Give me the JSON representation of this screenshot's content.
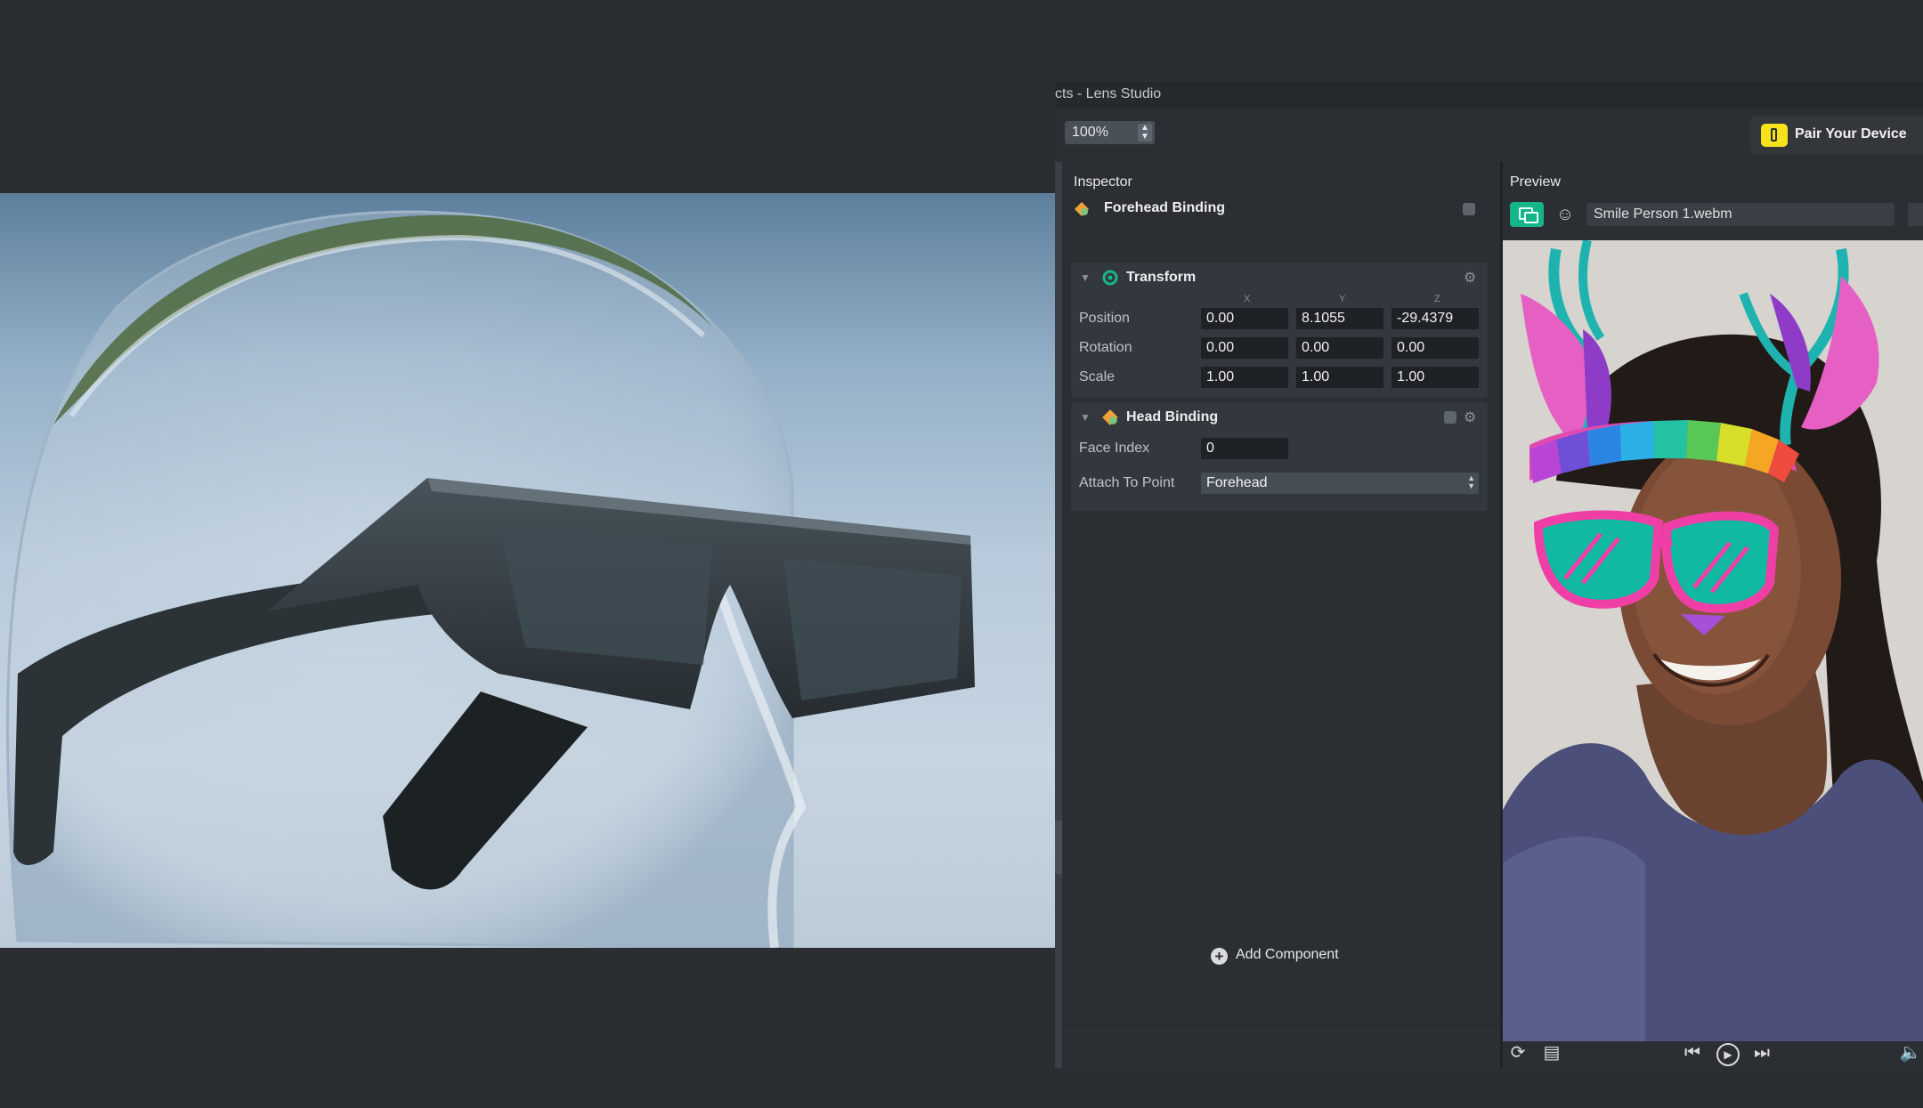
{
  "window": {
    "title": "cts - Lens Studio"
  },
  "toolbar": {
    "zoom": "100%",
    "pair_device_label": "Pair Your Device"
  },
  "inspector": {
    "title": "Inspector",
    "object_name": "Forehead Binding",
    "transform": {
      "title": "Transform",
      "axes": [
        "X",
        "Y",
        "Z"
      ],
      "rows": [
        {
          "label": "Position",
          "x": "0.00",
          "y": "8.1055",
          "z": "-29.4379"
        },
        {
          "label": "Rotation",
          "x": "0.00",
          "y": "0.00",
          "z": "0.00"
        },
        {
          "label": "Scale",
          "x": "1.00",
          "y": "1.00",
          "z": "1.00"
        }
      ]
    },
    "head_binding": {
      "title": "Head Binding",
      "face_index_label": "Face Index",
      "face_index_value": "0",
      "attach_label": "Attach To Point",
      "attach_value": "Forehead"
    },
    "add_component_label": "Add Component"
  },
  "preview": {
    "title": "Preview",
    "file": "Smile Person 1.webm"
  },
  "colors": {
    "accent_green": "#15b58b",
    "pair_yellow": "#f7e31c",
    "panel_bg": "#2b2f34"
  },
  "icons": [
    "forehead-binding-icon",
    "transform-icon",
    "head-binding-icon",
    "gear-icon",
    "phone-icon",
    "add-icon",
    "play-icon",
    "skip-back-icon",
    "skip-forward-icon",
    "volume-icon"
  ]
}
